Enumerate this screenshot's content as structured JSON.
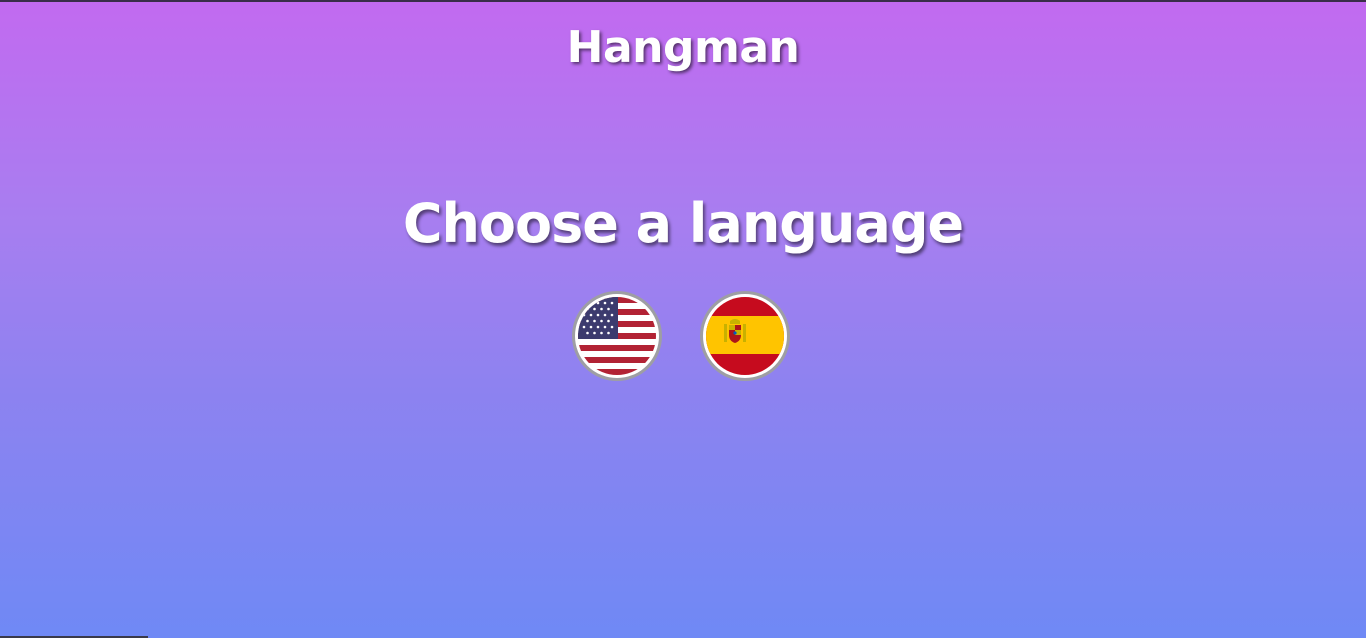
{
  "app": {
    "title": "Hangman"
  },
  "language_picker": {
    "prompt": "Choose a language",
    "options": [
      {
        "name": "English",
        "icon": "us-flag-icon"
      },
      {
        "name": "Spanish",
        "icon": "spain-flag-icon"
      }
    ]
  },
  "colors": {
    "background_top": "#c26af0",
    "background_bottom": "#6f89f5",
    "text": "#ffffff"
  }
}
